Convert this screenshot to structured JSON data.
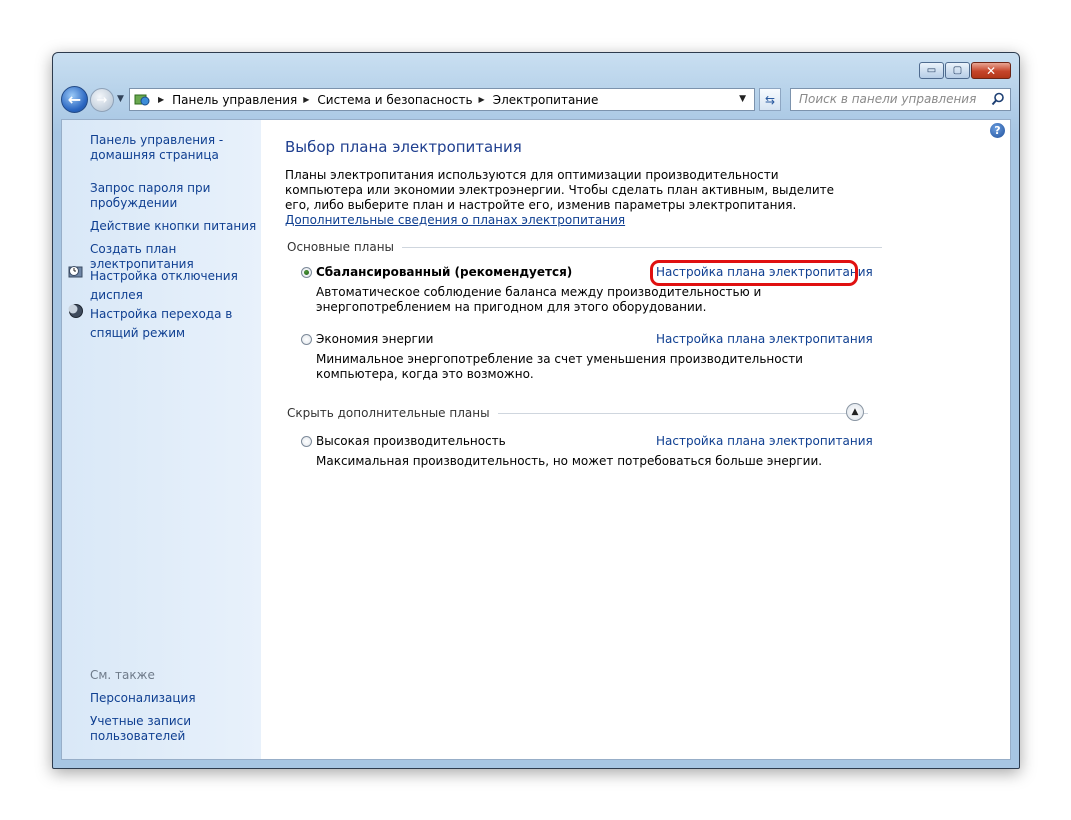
{
  "titlebar": {
    "minimize_glyph": "▭",
    "maximize_glyph": "▢",
    "close_glyph": "✕"
  },
  "addressbar": {
    "crumbs": [
      "Панель управления",
      "Система и безопасность",
      "Электропитание"
    ],
    "search_placeholder": "Поиск в панели управления"
  },
  "sidebar": {
    "home_link": "Панель управления - домашняя страница",
    "links": [
      {
        "label": "Запрос пароля при пробуждении",
        "icon": ""
      },
      {
        "label": "Действие кнопки питания",
        "icon": ""
      },
      {
        "label": "Создать план электропитания",
        "icon": ""
      },
      {
        "label": "Настройка отключения дисплея",
        "icon": "display-clock-icon"
      },
      {
        "label": "Настройка перехода в спящий режим",
        "icon": "moon-icon"
      }
    ],
    "see_also_title": "См. также",
    "see_also": [
      "Персонализация",
      "Учетные записи пользователей"
    ]
  },
  "main": {
    "title": "Выбор плана электропитания",
    "intro_text": "Планы электропитания используются для оптимизации производительности компьютера или экономии электроэнергии. Чтобы сделать план активным, выделите его, либо выберите план и настройте его, изменив параметры электропитания.",
    "intro_link": "Дополнительные сведения о планах электропитания",
    "basic_plans_title": "Основные планы",
    "hidden_plans_title": "Скрыть дополнительные планы",
    "plans": [
      {
        "name": "Сбалансированный (рекомендуется)",
        "selected": true,
        "link": "Настройка плана электропитания",
        "description": "Автоматическое соблюдение баланса между производительностью и энергопотреблением на пригодном для этого оборудовании."
      },
      {
        "name": "Экономия энергии",
        "selected": false,
        "link": "Настройка плана электропитания",
        "description": "Минимальное энергопотребление за счет уменьшения производительности компьютера, когда это возможно."
      },
      {
        "name": "Высокая производительность",
        "selected": false,
        "link": "Настройка плана электропитания",
        "description": "Максимальная производительность, но может потребоваться больше энергии."
      }
    ]
  },
  "colors": {
    "link": "#0f3f91",
    "title": "#1f3f8f",
    "highlight": "#e01010"
  }
}
